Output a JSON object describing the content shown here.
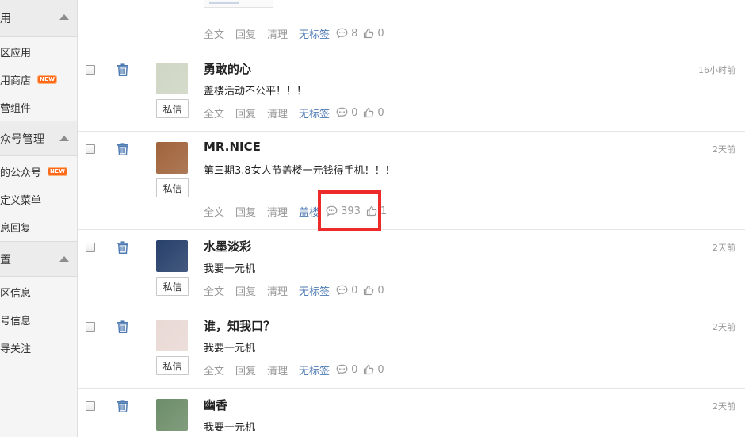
{
  "sidebar": {
    "sections": [
      {
        "title": "用",
        "items": [
          {
            "label": "区应用",
            "badge": ""
          },
          {
            "label": "用商店",
            "badge": "NEW"
          },
          {
            "label": "营组件",
            "badge": ""
          }
        ]
      },
      {
        "title": "众号管理",
        "items": [
          {
            "label": "的公众号",
            "badge": "NEW"
          },
          {
            "label": "定义菜单",
            "badge": ""
          },
          {
            "label": "息回复",
            "badge": ""
          }
        ]
      },
      {
        "title": "置",
        "items": [
          {
            "label": "区信息",
            "badge": ""
          },
          {
            "label": "号信息",
            "badge": ""
          },
          {
            "label": "导关注",
            "badge": ""
          }
        ]
      }
    ]
  },
  "labels": {
    "private_message": "私信"
  },
  "actions": {
    "full": "全文",
    "reply": "回复",
    "clear": "清理"
  },
  "top_row": {
    "tag": "无标签",
    "comments": "8",
    "likes": "0"
  },
  "posts": [
    {
      "name": "勇敢的心",
      "content": "盖楼活动不公平！！！",
      "time": "16小时前",
      "tag": "无标签",
      "comments": "0",
      "likes": "0",
      "avatar_color": "#cfd6c4"
    },
    {
      "name": "MR.NICE",
      "content": "第三期3.8女人节盖楼一元钱得手机！！！",
      "time": "2天前",
      "tag": "盖楼",
      "comments": "393",
      "likes": "1",
      "avatar_color": "#a0643c"
    },
    {
      "name": "水墨淡彩",
      "content": "我要一元机",
      "time": "2天前",
      "tag": "无标签",
      "comments": "0",
      "likes": "0",
      "avatar_color": "#27406b"
    },
    {
      "name": "谁，知我口？",
      "content": "我要一元机",
      "time": "2天前",
      "tag": "无标签",
      "comments": "0",
      "likes": "0",
      "avatar_color": "#ead9d5"
    },
    {
      "name": "幽香",
      "content": "我要一元机",
      "time": "2天前",
      "tag": "",
      "comments": "",
      "likes": "",
      "avatar_color": "#6d8d69"
    }
  ],
  "colors": {
    "tag": "#4f7bb3",
    "highlight": "#ee2b2b",
    "new_badge": "#ff6a1a"
  }
}
